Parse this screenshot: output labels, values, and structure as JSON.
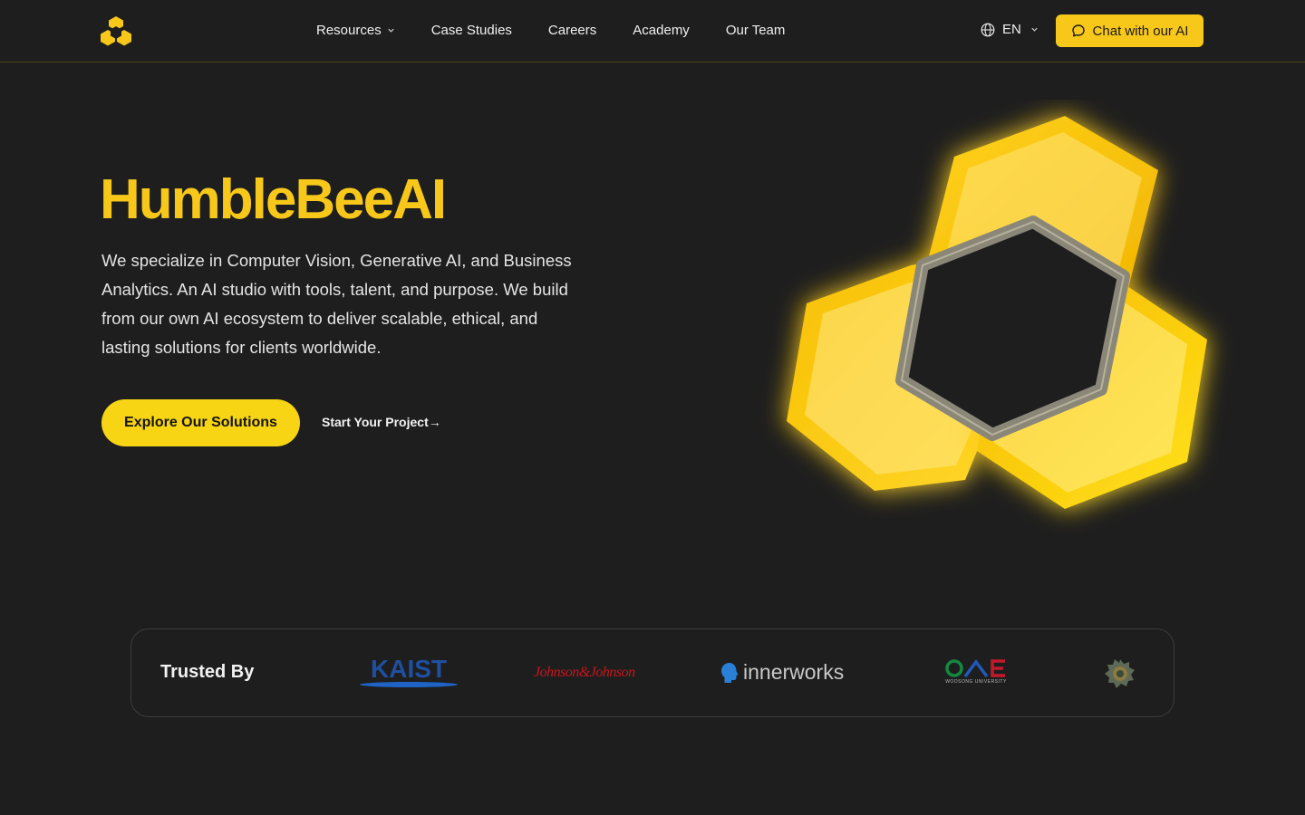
{
  "header": {
    "logo_icon": "honeycomb-logo-icon",
    "nav": [
      {
        "label": "Resources",
        "has_dropdown": true
      },
      {
        "label": "Case Studies",
        "has_dropdown": false
      },
      {
        "label": "Careers",
        "has_dropdown": false
      },
      {
        "label": "Academy",
        "has_dropdown": false
      },
      {
        "label": "Our Team",
        "has_dropdown": false
      }
    ],
    "language": "EN",
    "chat_button": "Chat with our AI"
  },
  "hero": {
    "title": "HumbleBeeAI",
    "description": "We specialize in Computer Vision, Generative AI, and Business Analytics. An AI studio with tools, talent, and purpose. We build from our own AI ecosystem to deliver scalable, ethical, and lasting solutions for clients worldwide.",
    "primary_cta": "Explore Our Solutions",
    "secondary_cta": "Start Your Project→"
  },
  "trusted": {
    "label": "Trusted By",
    "partners": {
      "kaist": "KAIST",
      "jnj": "Johnson&Johnson",
      "innerworks": "innerworks",
      "woosong_caption": "WOOSONG UNIVERSITY"
    }
  },
  "colors": {
    "accent": "#f7c81a",
    "background": "#1e1e1e",
    "button_yellow": "#f7d414"
  }
}
